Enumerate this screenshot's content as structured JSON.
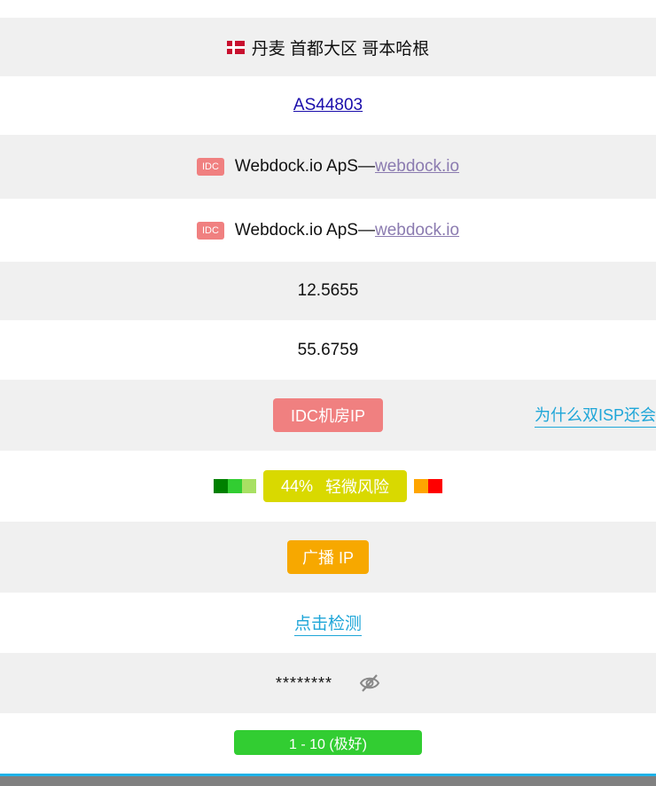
{
  "location": {
    "flag": "denmark-flag",
    "text": "丹麦 首都大区 哥本哈根"
  },
  "asn": {
    "label": "AS44803"
  },
  "isp_primary": {
    "badge": "IDC",
    "name": "Webdock.io ApS—",
    "link": "webdock.io"
  },
  "isp_secondary": {
    "badge": "IDC",
    "name": "Webdock.io ApS—",
    "link": "webdock.io"
  },
  "longitude": "12.5655",
  "latitude": "55.6759",
  "usage_type": {
    "tag": "IDC机房IP",
    "help_link": "为什么双ISP还会"
  },
  "risk": {
    "percent": "44%",
    "label": "轻微风险",
    "left_colors": [
      "#008000",
      "#32cd32",
      "#a8e063"
    ],
    "right_colors": [
      "#ffa500",
      "#ff0000"
    ],
    "badge_color": "#d9d900"
  },
  "broadcast": {
    "tag": "广播 IP"
  },
  "native_check": {
    "link": "点击检测"
  },
  "password": {
    "masked": "********",
    "icon": "eye-slash-icon"
  },
  "rating": {
    "label": "1 - 10 (极好)"
  },
  "colors": {
    "idc": "#f08080",
    "broadcast": "#f7a800",
    "rating": "#32cd32",
    "cyan_link": "#1fa6d8"
  }
}
